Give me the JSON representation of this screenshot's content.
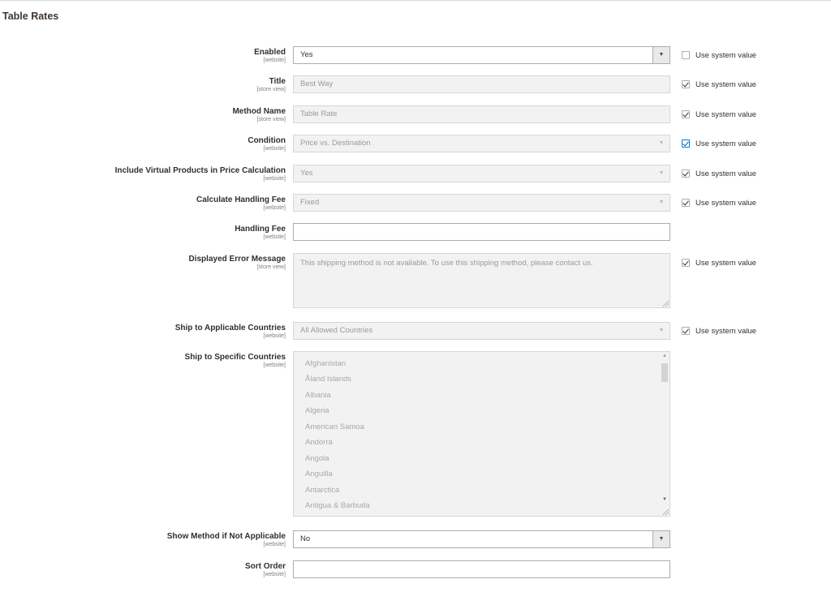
{
  "section": {
    "title": "Table Rates"
  },
  "system_value_label": "Use system value",
  "fields": {
    "enabled": {
      "label": "Enabled",
      "scope": "[website]",
      "value": "Yes"
    },
    "title": {
      "label": "Title",
      "scope": "[store view]",
      "value": "Best Way"
    },
    "method_name": {
      "label": "Method Name",
      "scope": "[store view]",
      "value": "Table Rate"
    },
    "condition": {
      "label": "Condition",
      "scope": "[website]",
      "value": "Price vs. Destination"
    },
    "include_virtual": {
      "label": "Include Virtual Products in Price Calculation",
      "scope": "[website]",
      "value": "Yes"
    },
    "calc_handling_fee": {
      "label": "Calculate Handling Fee",
      "scope": "[website]",
      "value": "Fixed"
    },
    "handling_fee": {
      "label": "Handling Fee",
      "scope": "[website]",
      "value": ""
    },
    "error_message": {
      "label": "Displayed Error Message",
      "scope": "[store view]",
      "value": "This shipping method is not available. To use this shipping method, please contact us."
    },
    "applicable_countries": {
      "label": "Ship to Applicable Countries",
      "scope": "[website]",
      "value": "All Allowed Countries"
    },
    "specific_countries": {
      "label": "Ship to Specific Countries",
      "scope": "[website]",
      "options": [
        "Afghanistan",
        "Åland Islands",
        "Albania",
        "Algeria",
        "American Samoa",
        "Andorra",
        "Angola",
        "Anguilla",
        "Antarctica",
        "Antigua & Barbuda"
      ]
    },
    "show_method": {
      "label": "Show Method if Not Applicable",
      "scope": "[website]",
      "value": "No"
    },
    "sort_order": {
      "label": "Sort Order",
      "scope": "[website]",
      "value": ""
    }
  },
  "use_system_value": {
    "enabled": false,
    "title": true,
    "method_name": true,
    "condition": true,
    "include_virtual": true,
    "calc_handling_fee": true,
    "error_message": true,
    "applicable_countries": true
  },
  "icons": {
    "dropdown_arrow": "▼",
    "scroll_up": "▲",
    "scroll_down": "▼"
  },
  "colors": {
    "focus_border": "#007bdb",
    "disabled_background": "#f2f2f2"
  }
}
